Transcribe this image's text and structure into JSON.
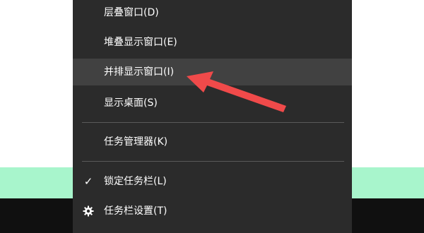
{
  "menu": {
    "items": [
      {
        "label": "层叠窗口(D)"
      },
      {
        "label": "堆叠显示窗口(E)"
      },
      {
        "label": "并排显示窗口(I)"
      },
      {
        "label": "显示桌面(S)"
      },
      {
        "label": "任务管理器(K)"
      },
      {
        "label": "锁定任务栏(L)",
        "icon": "checkmark-icon"
      },
      {
        "label": "任务栏设置(T)",
        "icon": "gear-icon"
      }
    ]
  },
  "colors": {
    "menu_bg": "#2b2b2b",
    "menu_hover": "#414141",
    "separator": "#5a5a5a",
    "mint_strip": "#a8f5cc",
    "taskbar": "#101010",
    "annotation_arrow": "#f04a4a"
  },
  "annotation": {
    "icon": "red-arrow-annotation"
  }
}
